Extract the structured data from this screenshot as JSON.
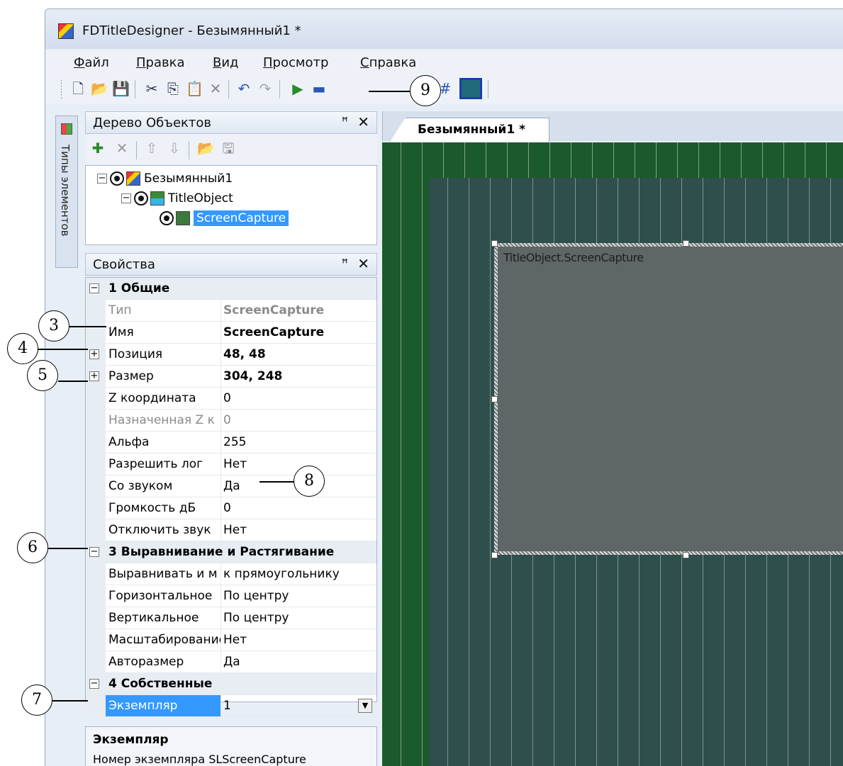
{
  "window": {
    "title": "FDTitleDesigner - Безымянный1 *"
  },
  "menu": [
    {
      "accel": "Ф",
      "rest": "айл"
    },
    {
      "accel": "П",
      "rest": "равка"
    },
    {
      "accel": "В",
      "rest": "ид"
    },
    {
      "accel": "П",
      "rest": "росмотр"
    },
    {
      "accel": "С",
      "rest": "правка"
    }
  ],
  "toolbar_icons": [
    "new-file-icon",
    "open-folder-icon",
    "save-icon",
    "cut-icon",
    "copy-icon",
    "paste-icon",
    "delete-icon",
    "undo-icon",
    "redo-icon",
    "play-icon",
    "stop-icon",
    "grid-icon",
    "color-icon"
  ],
  "sidetab": {
    "label": "Типы элементов"
  },
  "object_tree": {
    "title": "Дерево Объектов",
    "pin": "ᛜ",
    "close": "✕",
    "nodes": [
      {
        "label": "Безымянный1",
        "level": 0
      },
      {
        "label": "TitleObject",
        "level": 1
      },
      {
        "label": "ScreenCapture",
        "level": 2,
        "selected": true
      }
    ]
  },
  "properties": {
    "title": "Свойства",
    "categories": {
      "general": "1 Общие",
      "align": "3 Выравнивание и Растягивание",
      "own": "4 Собственные"
    },
    "rows": {
      "type": {
        "name": "Тип",
        "value": "ScreenCapture"
      },
      "name": {
        "name": "Имя",
        "value": "ScreenCapture"
      },
      "position": {
        "name": "Позиция",
        "value": "48, 48"
      },
      "size": {
        "name": "Размер",
        "value": "304, 248"
      },
      "z": {
        "name": "Z координата",
        "value": "0"
      },
      "assigned_z": {
        "name": "Назначенная Z к",
        "value": "0"
      },
      "alpha": {
        "name": "Альфа",
        "value": "255"
      },
      "allow_log": {
        "name": "Разрешить лог",
        "value": "Нет"
      },
      "sound": {
        "name": "Со звуком",
        "value": "Да"
      },
      "volume": {
        "name": "Громкость дБ",
        "value": "0"
      },
      "mute": {
        "name": "Отключить звук",
        "value": "Нет"
      },
      "align_by": {
        "name": "Выравнивать и м",
        "value": "к прямоугольнику"
      },
      "horizontal": {
        "name": "Горизонтальное",
        "value": "По центру"
      },
      "vertical": {
        "name": "Вертикальное",
        "value": "По центру"
      },
      "scaling": {
        "name": "Масштабирование",
        "value": "Нет"
      },
      "autosize": {
        "name": "Авторазмер",
        "value": "Да"
      },
      "instance": {
        "name": "Экземпляр",
        "value": "1"
      }
    },
    "description": {
      "title": "Экземпляр",
      "text": "Номер экземпляра SLScreenCapture"
    }
  },
  "document": {
    "tab": "Безымянный1 *",
    "object_label": "TitleObject.ScreenCapture"
  },
  "callouts": [
    "3",
    "4",
    "5",
    "6",
    "7",
    "8",
    "9"
  ],
  "colors": {
    "outer_canvas": "#1b5a2a",
    "inner_canvas": "#2e4f4c",
    "selection": "#3399ff",
    "capture_fill": "#5f6668"
  }
}
